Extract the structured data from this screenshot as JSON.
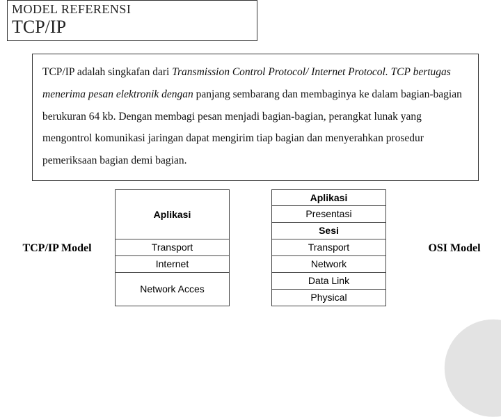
{
  "header": {
    "line1": "MODEL REFERENSI",
    "line2": "TCP/IP"
  },
  "paragraph": {
    "s1a": "TCP/IP adalah singkafan dari ",
    "s1b": "Transmission Control Protocol/ Internet Protocol. TCP bertugas menerima pesan elektronik dengan",
    "s1c": " panjang sembarang dan membaginya ke dalam bagian-bagian berukuran 64 kb. Dengan membagi pesan menjadi bagian-bagian, perangkat lunak yang mengontrol komunikasi jaringan dapat mengirim tiap bagian dan menyerahkan prosedur pemeriksaan bagian demi bagian."
  },
  "labels": {
    "tcpip_model": "TCP/IP Model",
    "osi_model": "OSI Model"
  },
  "tcpip_layers": {
    "l1": "Aplikasi",
    "l2": "Transport",
    "l3": "Internet",
    "l4": "Network Acces"
  },
  "osi_layers": {
    "r1": "Aplikasi",
    "r2": "Presentasi",
    "r3": "Sesi",
    "r4": "Transport",
    "r5": "Network",
    "r6": "Data Link",
    "r7": "Physical"
  }
}
